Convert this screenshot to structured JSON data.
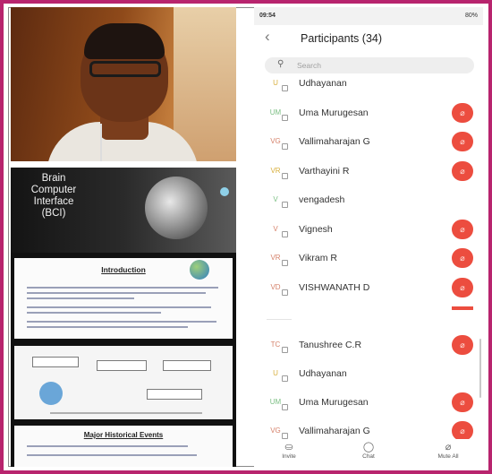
{
  "slide": {
    "title_lines": [
      "Brain",
      "Computer",
      "Interface",
      "(BCI)"
    ],
    "intro_heading": "Introduction",
    "history_heading": "Major Historical Events"
  },
  "phone": {
    "status": {
      "time": "09:54",
      "battery": "80%"
    },
    "header": {
      "back_icon": "chevron-left-icon",
      "title": "Participants (34)"
    },
    "search": {
      "placeholder": "Search"
    },
    "participants_top": [
      {
        "initials": "U",
        "name": "Udhayanan",
        "avatar_color": "yellow",
        "mic": false
      },
      {
        "initials": "UM",
        "name": "Uma Murugesan",
        "avatar_color": "green",
        "mic": true
      },
      {
        "initials": "VG",
        "name": "Vallimaharajan G",
        "avatar_color": "red",
        "mic": true
      },
      {
        "initials": "VR",
        "name": "Varthayini R",
        "avatar_color": "yellow",
        "mic": true
      },
      {
        "initials": "V",
        "name": "vengadesh",
        "avatar_color": "green",
        "mic": false
      },
      {
        "initials": "V",
        "name": "Vignesh",
        "avatar_color": "red",
        "mic": true
      },
      {
        "initials": "VR",
        "name": "Vikram R",
        "avatar_color": "red",
        "mic": true
      },
      {
        "initials": "VD",
        "name": "VISHWANATH D",
        "avatar_color": "red",
        "mic": true
      }
    ],
    "participants_bottom": [
      {
        "initials": "TC",
        "name": "Tanushree C.R",
        "avatar_color": "red",
        "mic": true
      },
      {
        "initials": "U",
        "name": "Udhayanan",
        "avatar_color": "yellow",
        "mic": false
      },
      {
        "initials": "UM",
        "name": "Uma Murugesan",
        "avatar_color": "green",
        "mic": true
      },
      {
        "initials": "VG",
        "name": "Vallimaharajan G",
        "avatar_color": "red",
        "mic": true
      }
    ],
    "bottom_bar": [
      {
        "icon": "person-add-icon",
        "label": "Invite"
      },
      {
        "icon": "chat-icon",
        "label": "Chat"
      },
      {
        "icon": "mute-all-icon",
        "label": "Mute All"
      }
    ]
  },
  "colors": {
    "frame": "#b8246e",
    "mic_badge": "#ec4d3f"
  }
}
